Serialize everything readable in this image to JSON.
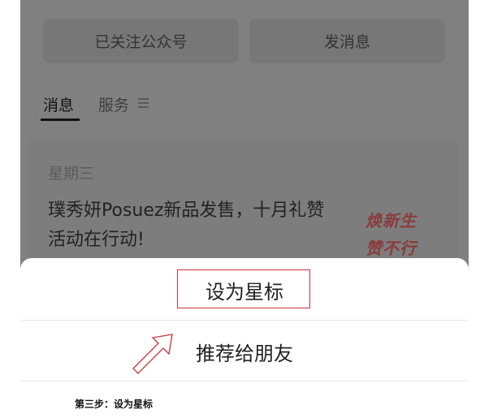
{
  "header": {
    "followed_label": "已关注公众号",
    "message_label": "发消息"
  },
  "tabs": {
    "messages": "消息",
    "services": "服务"
  },
  "card": {
    "day": "星期三",
    "title": "璞秀妍Posuez新品发售，十月礼赞活动在行动!",
    "thumb_line1": "焕新生",
    "thumb_line2": "赞不行"
  },
  "sheet": {
    "set_star": "设为星标",
    "recommend": "推荐给朋友"
  },
  "caption": "第三步：设为星标",
  "icons": {
    "arrow": "arrow-up-right-icon",
    "menu": "menu-lines-icon"
  },
  "colors": {
    "highlight": "#c7323a",
    "overlay": "#808080"
  }
}
